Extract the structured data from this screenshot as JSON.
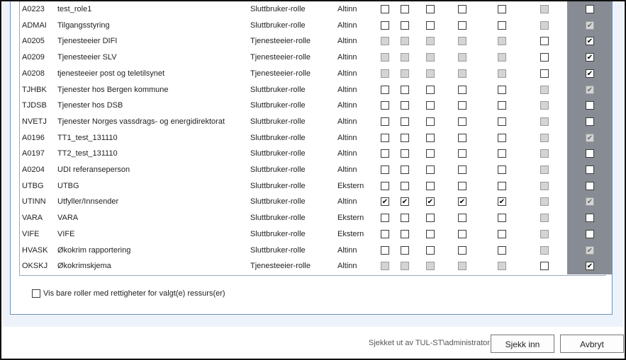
{
  "rows": [
    {
      "code": "A0223",
      "name": "test_role1",
      "type": "Sluttbruker-rolle",
      "source": "Altinn",
      "perms": [
        "o",
        "o",
        "o",
        "o",
        "o",
        "d"
      ],
      "last": "o"
    },
    {
      "code": "ADMAI",
      "name": "Tilgangsstyring",
      "type": "Sluttbruker-rolle",
      "source": "Altinn",
      "perms": [
        "o",
        "o",
        "o",
        "o",
        "o",
        "d"
      ],
      "last": "dc"
    },
    {
      "code": "A0205",
      "name": "Tjenesteeier DIFI",
      "type": "Tjenesteeier-rolle",
      "source": "Altinn",
      "perms": [
        "d",
        "d",
        "d",
        "d",
        "d",
        "o"
      ],
      "last": "c"
    },
    {
      "code": "A0209",
      "name": "Tjenesteeier SLV",
      "type": "Tjenesteeier-rolle",
      "source": "Altinn",
      "perms": [
        "d",
        "d",
        "d",
        "d",
        "d",
        "o"
      ],
      "last": "c"
    },
    {
      "code": "A0208",
      "name": "tjenesteeier post og teletilsynet",
      "type": "Tjenesteeier-rolle",
      "source": "Altinn",
      "perms": [
        "d",
        "d",
        "d",
        "d",
        "d",
        "o"
      ],
      "last": "c"
    },
    {
      "code": "TJHBK",
      "name": "Tjenester hos Bergen kommune",
      "type": "Sluttbruker-rolle",
      "source": "Altinn",
      "perms": [
        "o",
        "o",
        "o",
        "o",
        "o",
        "d"
      ],
      "last": "dc"
    },
    {
      "code": "TJDSB",
      "name": "Tjenester hos DSB",
      "type": "Sluttbruker-rolle",
      "source": "Altinn",
      "perms": [
        "o",
        "o",
        "o",
        "o",
        "o",
        "d"
      ],
      "last": "o"
    },
    {
      "code": "NVETJ",
      "name": "Tjenester Norges vassdrags- og energidirektorat",
      "type": "Sluttbruker-rolle",
      "source": "Altinn",
      "perms": [
        "o",
        "o",
        "o",
        "o",
        "o",
        "d"
      ],
      "last": "o"
    },
    {
      "code": "A0196",
      "name": "TT1_test_131110",
      "type": "Sluttbruker-rolle",
      "source": "Altinn",
      "perms": [
        "o",
        "o",
        "o",
        "o",
        "o",
        "d"
      ],
      "last": "dc"
    },
    {
      "code": "A0197",
      "name": "TT2_test_131110",
      "type": "Sluttbruker-rolle",
      "source": "Altinn",
      "perms": [
        "o",
        "o",
        "o",
        "o",
        "o",
        "d"
      ],
      "last": "o"
    },
    {
      "code": "A0204",
      "name": "UDI referanseperson",
      "type": "Sluttbruker-rolle",
      "source": "Altinn",
      "perms": [
        "o",
        "o",
        "o",
        "o",
        "o",
        "d"
      ],
      "last": "o"
    },
    {
      "code": "UTBG",
      "name": "UTBG",
      "type": "Sluttbruker-rolle",
      "source": "Ekstern",
      "perms": [
        "o",
        "o",
        "o",
        "o",
        "o",
        "d"
      ],
      "last": "o"
    },
    {
      "code": "UTINN",
      "name": "Utfyller/Innsender",
      "type": "Sluttbruker-rolle",
      "source": "Altinn",
      "perms": [
        "c",
        "c",
        "c",
        "c",
        "c",
        "d"
      ],
      "last": "dc"
    },
    {
      "code": "VARA",
      "name": "VARA",
      "type": "Sluttbruker-rolle",
      "source": "Ekstern",
      "perms": [
        "o",
        "o",
        "o",
        "o",
        "o",
        "d"
      ],
      "last": "o"
    },
    {
      "code": "VIFE",
      "name": "VIFE",
      "type": "Sluttbruker-rolle",
      "source": "Ekstern",
      "perms": [
        "o",
        "o",
        "o",
        "o",
        "o",
        "d"
      ],
      "last": "o"
    },
    {
      "code": "HVASK",
      "name": "Økokrim rapportering",
      "type": "Sluttbruker-rolle",
      "source": "Altinn",
      "perms": [
        "o",
        "o",
        "o",
        "o",
        "o",
        "d"
      ],
      "last": "dc"
    },
    {
      "code": "OKSKJ",
      "name": "Økokrimskjema",
      "type": "Tjenesteeier-rolle",
      "source": "Altinn",
      "perms": [
        "d",
        "d",
        "d",
        "d",
        "d",
        "o"
      ],
      "last": "c"
    }
  ],
  "filter": {
    "label": "Vis bare roller med rettigheter for valgt(e) ressurs(er)",
    "checked": false
  },
  "footer": {
    "checked_out_by": "Sjekket ut av TUL-ST\\administrator",
    "checkin_label": "Sjekk inn",
    "cancel_label": "Avbryt"
  }
}
